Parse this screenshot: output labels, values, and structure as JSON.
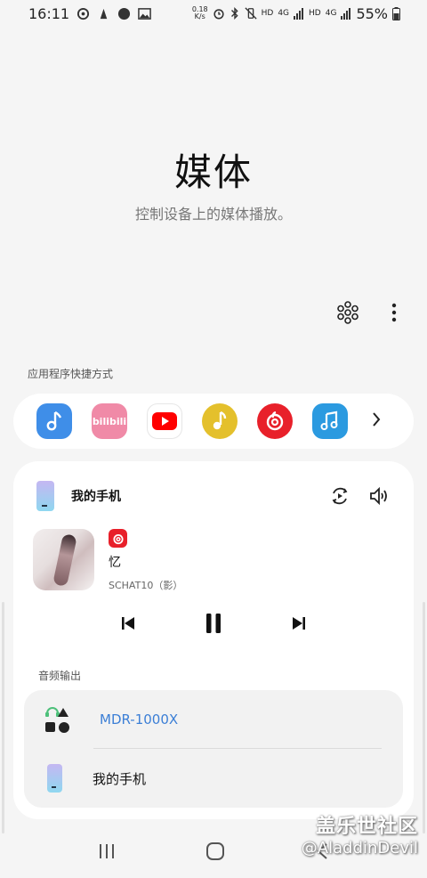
{
  "status_bar": {
    "time": "16:11",
    "net_speed_value": "0.18",
    "net_speed_unit": "K/s",
    "hd1": "HD",
    "lte1": "4G",
    "hd2": "HD",
    "lte2": "4G",
    "battery": "55%"
  },
  "hero": {
    "title": "媒体",
    "subtitle": "控制设备上的媒体播放。"
  },
  "shortcuts": {
    "section_label": "应用程序快捷方式",
    "apps": [
      "music-app-icon",
      "bilibili-app-icon",
      "youtube-app-icon",
      "yellow-music-app-icon",
      "netease-music-app-icon",
      "blue-music-app-icon"
    ],
    "bilibili_text": "bilibili"
  },
  "media": {
    "device_name": "我的手机",
    "track_title": "忆",
    "track_artist": "SCHAT10（影）",
    "state": "playing"
  },
  "audio_output": {
    "section_label": "音频输出",
    "items": [
      {
        "label": "MDR-1000X",
        "active": true
      },
      {
        "label": "我的手机",
        "active": false
      }
    ]
  },
  "watermark": {
    "cn": "盖乐世社区",
    "en": "@AladdinDevil"
  },
  "colors": {
    "accent": "#3c7fd6",
    "netease_red": "#e8202a",
    "background": "#f5f5f5"
  }
}
